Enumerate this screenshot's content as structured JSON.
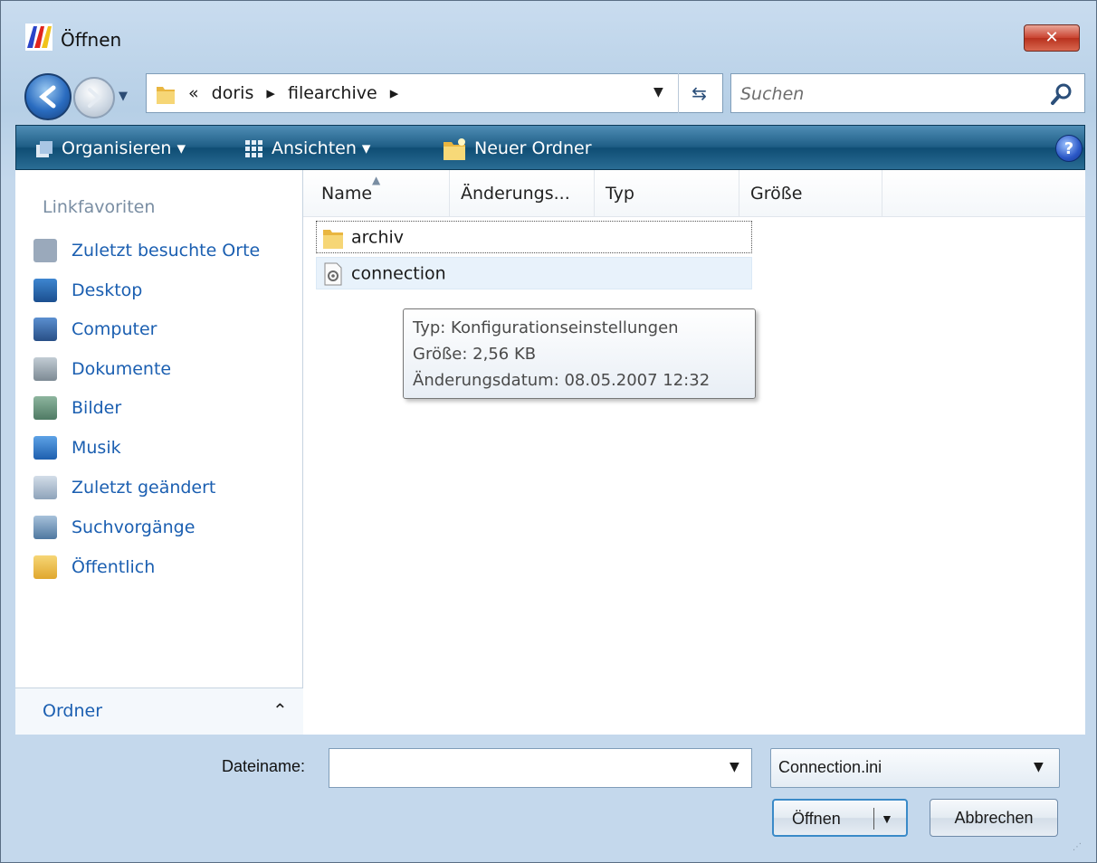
{
  "window": {
    "title": "Öffnen",
    "close_glyph": "✕"
  },
  "nav": {
    "breadcrumb": [
      "«",
      "doris",
      "▸",
      "filearchive",
      "▸"
    ],
    "search_placeholder": "Suchen"
  },
  "toolbar": {
    "organize": "Organisieren ▾",
    "views": "Ansichten ▾",
    "new_folder": "Neuer Ordner",
    "help": "?"
  },
  "sidebar": {
    "header": "Linkfavoriten",
    "items": [
      {
        "label": "Zuletzt besuchte Orte",
        "icon": "recent-places-icon",
        "color": "#7d8fa6"
      },
      {
        "label": "Desktop",
        "icon": "desktop-icon",
        "color": "#2a6fb8"
      },
      {
        "label": "Computer",
        "icon": "computer-icon",
        "color": "#3b6ea8"
      },
      {
        "label": "Dokumente",
        "icon": "documents-icon",
        "color": "#8d9aa3"
      },
      {
        "label": "Bilder",
        "icon": "pictures-icon",
        "color": "#5f8a74"
      },
      {
        "label": "Musik",
        "icon": "music-icon",
        "color": "#2e75c6"
      },
      {
        "label": "Zuletzt geändert",
        "icon": "recently-changed-icon",
        "color": "#8aa0b8"
      },
      {
        "label": "Suchvorgänge",
        "icon": "searches-icon",
        "color": "#6b8fb0"
      },
      {
        "label": "Öffentlich",
        "icon": "public-folder-icon",
        "color": "#e9b640"
      }
    ],
    "folders_label": "Ordner",
    "folders_chevron": "⌃"
  },
  "filelist": {
    "columns": [
      "Name",
      "Änderungs...",
      "Typ",
      "Größe"
    ],
    "sort_indicator": "▲",
    "rows": [
      {
        "name": "archiv",
        "icon": "folder-icon"
      },
      {
        "name": "connection",
        "icon": "config-file-icon"
      }
    ],
    "tooltip": {
      "line1": "Typ: Konfigurationseinstellungen",
      "line2": "Größe: 2,56 KB",
      "line3": "Änderungsdatum: 08.05.2007 12:32"
    }
  },
  "bottom": {
    "filename_label": "Dateiname:",
    "filename_value": "",
    "filter_value": "Connection.ini",
    "open_label": "Öffnen",
    "cancel_label": "Abbrechen"
  },
  "colors": {
    "toolbar": "#1f5e86",
    "link": "#1b5fb1",
    "accent": "#3a8ac8"
  }
}
